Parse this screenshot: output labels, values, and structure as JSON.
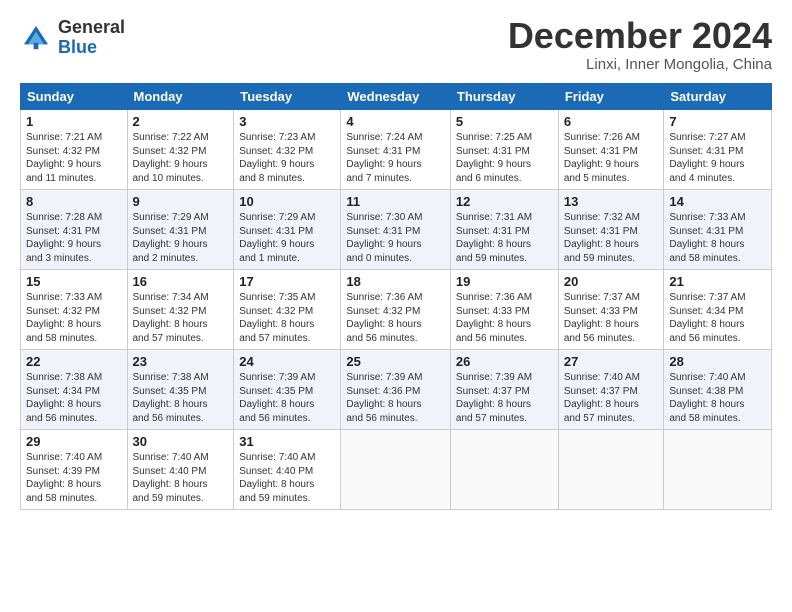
{
  "logo": {
    "general": "General",
    "blue": "Blue"
  },
  "title": "December 2024",
  "subtitle": "Linxi, Inner Mongolia, China",
  "days_header": [
    "Sunday",
    "Monday",
    "Tuesday",
    "Wednesday",
    "Thursday",
    "Friday",
    "Saturday"
  ],
  "weeks": [
    [
      {
        "day": "1",
        "text": "Sunrise: 7:21 AM\nSunset: 4:32 PM\nDaylight: 9 hours\nand 11 minutes."
      },
      {
        "day": "2",
        "text": "Sunrise: 7:22 AM\nSunset: 4:32 PM\nDaylight: 9 hours\nand 10 minutes."
      },
      {
        "day": "3",
        "text": "Sunrise: 7:23 AM\nSunset: 4:32 PM\nDaylight: 9 hours\nand 8 minutes."
      },
      {
        "day": "4",
        "text": "Sunrise: 7:24 AM\nSunset: 4:31 PM\nDaylight: 9 hours\nand 7 minutes."
      },
      {
        "day": "5",
        "text": "Sunrise: 7:25 AM\nSunset: 4:31 PM\nDaylight: 9 hours\nand 6 minutes."
      },
      {
        "day": "6",
        "text": "Sunrise: 7:26 AM\nSunset: 4:31 PM\nDaylight: 9 hours\nand 5 minutes."
      },
      {
        "day": "7",
        "text": "Sunrise: 7:27 AM\nSunset: 4:31 PM\nDaylight: 9 hours\nand 4 minutes."
      }
    ],
    [
      {
        "day": "8",
        "text": "Sunrise: 7:28 AM\nSunset: 4:31 PM\nDaylight: 9 hours\nand 3 minutes."
      },
      {
        "day": "9",
        "text": "Sunrise: 7:29 AM\nSunset: 4:31 PM\nDaylight: 9 hours\nand 2 minutes."
      },
      {
        "day": "10",
        "text": "Sunrise: 7:29 AM\nSunset: 4:31 PM\nDaylight: 9 hours\nand 1 minute."
      },
      {
        "day": "11",
        "text": "Sunrise: 7:30 AM\nSunset: 4:31 PM\nDaylight: 9 hours\nand 0 minutes."
      },
      {
        "day": "12",
        "text": "Sunrise: 7:31 AM\nSunset: 4:31 PM\nDaylight: 8 hours\nand 59 minutes."
      },
      {
        "day": "13",
        "text": "Sunrise: 7:32 AM\nSunset: 4:31 PM\nDaylight: 8 hours\nand 59 minutes."
      },
      {
        "day": "14",
        "text": "Sunrise: 7:33 AM\nSunset: 4:31 PM\nDaylight: 8 hours\nand 58 minutes."
      }
    ],
    [
      {
        "day": "15",
        "text": "Sunrise: 7:33 AM\nSunset: 4:32 PM\nDaylight: 8 hours\nand 58 minutes."
      },
      {
        "day": "16",
        "text": "Sunrise: 7:34 AM\nSunset: 4:32 PM\nDaylight: 8 hours\nand 57 minutes."
      },
      {
        "day": "17",
        "text": "Sunrise: 7:35 AM\nSunset: 4:32 PM\nDaylight: 8 hours\nand 57 minutes."
      },
      {
        "day": "18",
        "text": "Sunrise: 7:36 AM\nSunset: 4:32 PM\nDaylight: 8 hours\nand 56 minutes."
      },
      {
        "day": "19",
        "text": "Sunrise: 7:36 AM\nSunset: 4:33 PM\nDaylight: 8 hours\nand 56 minutes."
      },
      {
        "day": "20",
        "text": "Sunrise: 7:37 AM\nSunset: 4:33 PM\nDaylight: 8 hours\nand 56 minutes."
      },
      {
        "day": "21",
        "text": "Sunrise: 7:37 AM\nSunset: 4:34 PM\nDaylight: 8 hours\nand 56 minutes."
      }
    ],
    [
      {
        "day": "22",
        "text": "Sunrise: 7:38 AM\nSunset: 4:34 PM\nDaylight: 8 hours\nand 56 minutes."
      },
      {
        "day": "23",
        "text": "Sunrise: 7:38 AM\nSunset: 4:35 PM\nDaylight: 8 hours\nand 56 minutes."
      },
      {
        "day": "24",
        "text": "Sunrise: 7:39 AM\nSunset: 4:35 PM\nDaylight: 8 hours\nand 56 minutes."
      },
      {
        "day": "25",
        "text": "Sunrise: 7:39 AM\nSunset: 4:36 PM\nDaylight: 8 hours\nand 56 minutes."
      },
      {
        "day": "26",
        "text": "Sunrise: 7:39 AM\nSunset: 4:37 PM\nDaylight: 8 hours\nand 57 minutes."
      },
      {
        "day": "27",
        "text": "Sunrise: 7:40 AM\nSunset: 4:37 PM\nDaylight: 8 hours\nand 57 minutes."
      },
      {
        "day": "28",
        "text": "Sunrise: 7:40 AM\nSunset: 4:38 PM\nDaylight: 8 hours\nand 58 minutes."
      }
    ],
    [
      {
        "day": "29",
        "text": "Sunrise: 7:40 AM\nSunset: 4:39 PM\nDaylight: 8 hours\nand 58 minutes."
      },
      {
        "day": "30",
        "text": "Sunrise: 7:40 AM\nSunset: 4:40 PM\nDaylight: 8 hours\nand 59 minutes."
      },
      {
        "day": "31",
        "text": "Sunrise: 7:40 AM\nSunset: 4:40 PM\nDaylight: 8 hours\nand 59 minutes."
      },
      null,
      null,
      null,
      null
    ]
  ]
}
